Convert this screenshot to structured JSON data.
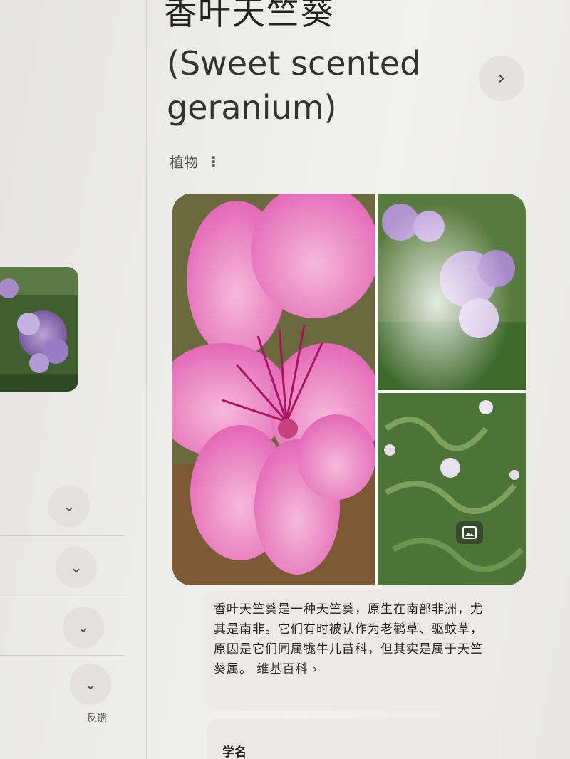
{
  "entity": {
    "title_cn": "香叶天竺葵",
    "title_en": "(Sweet scented geranium)",
    "category": "植物"
  },
  "description": {
    "text": "香叶天竺葵是一种天竺葵，原生在南部非洲，尤其是南非。它们有时被认作为老鹳草、驱蚊草，原因是它们同属牻牛儿苗科，但其实是属于天竺葵属。",
    "source_link": "维基百科 ›"
  },
  "sections": {
    "scientific_name_label": "学名"
  },
  "left_panel": {
    "feedback_label": "反馈",
    "expand_buttons": [
      "chevron-down",
      "chevron-down",
      "chevron-down",
      "chevron-down"
    ]
  },
  "icons": {
    "next": "chevron-right-icon",
    "more": "more-vert-icon",
    "images": "image-icon"
  },
  "colors": {
    "flower_pink": "#e56fb8",
    "foliage_green": "#4f7a3a",
    "background": "#ececea"
  }
}
